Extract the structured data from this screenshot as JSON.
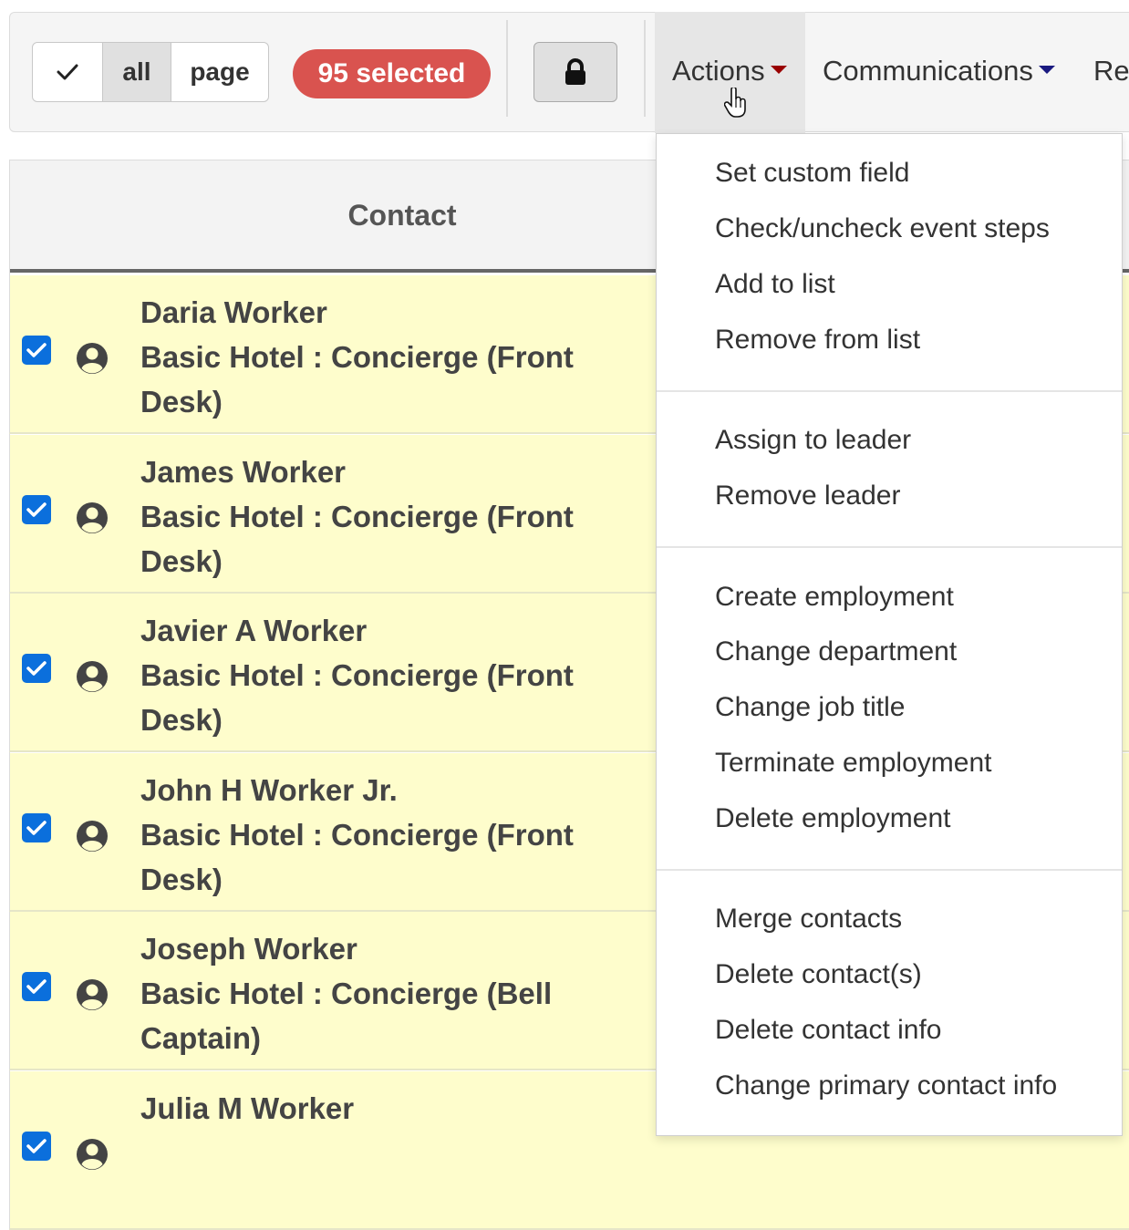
{
  "toolbar": {
    "seg_all": "all",
    "seg_page": "page",
    "selected_badge": "95 selected",
    "nav": {
      "actions": "Actions",
      "communications": "Communications",
      "reports_partial": "Re"
    }
  },
  "table": {
    "header_contact": "Contact",
    "rows": [
      {
        "name": "Daria Worker",
        "role": "Basic Hotel : Concierge (Front Desk)",
        "checked": true
      },
      {
        "name": "James Worker",
        "role": "Basic Hotel : Concierge (Front Desk)",
        "checked": true
      },
      {
        "name": "Javier A Worker",
        "role": "Basic Hotel : Concierge (Front Desk)",
        "checked": true
      },
      {
        "name": "John H Worker Jr.",
        "role": "Basic Hotel : Concierge (Front Desk)",
        "checked": true
      },
      {
        "name": "Joseph Worker",
        "role": "Basic Hotel : Concierge (Bell Captain)",
        "checked": true
      },
      {
        "name": "Julia M Worker",
        "role": "",
        "checked": true
      }
    ]
  },
  "actions_menu": {
    "groups": [
      [
        "Set custom field",
        "Check/uncheck event steps",
        "Add to list",
        "Remove from list"
      ],
      [
        "Assign to leader",
        "Remove leader"
      ],
      [
        "Create employment",
        "Change department",
        "Change job title",
        "Terminate employment",
        "Delete employment"
      ],
      [
        "Merge contacts",
        "Delete contact(s)",
        "Delete contact info",
        "Change primary contact info"
      ]
    ]
  },
  "colors": {
    "badge": "#d9534f",
    "row_selected_bg": "#fefdcc",
    "checkbox": "#0b6fdc",
    "actions_caret": "#990000",
    "communications_caret": "#1a1a80"
  }
}
